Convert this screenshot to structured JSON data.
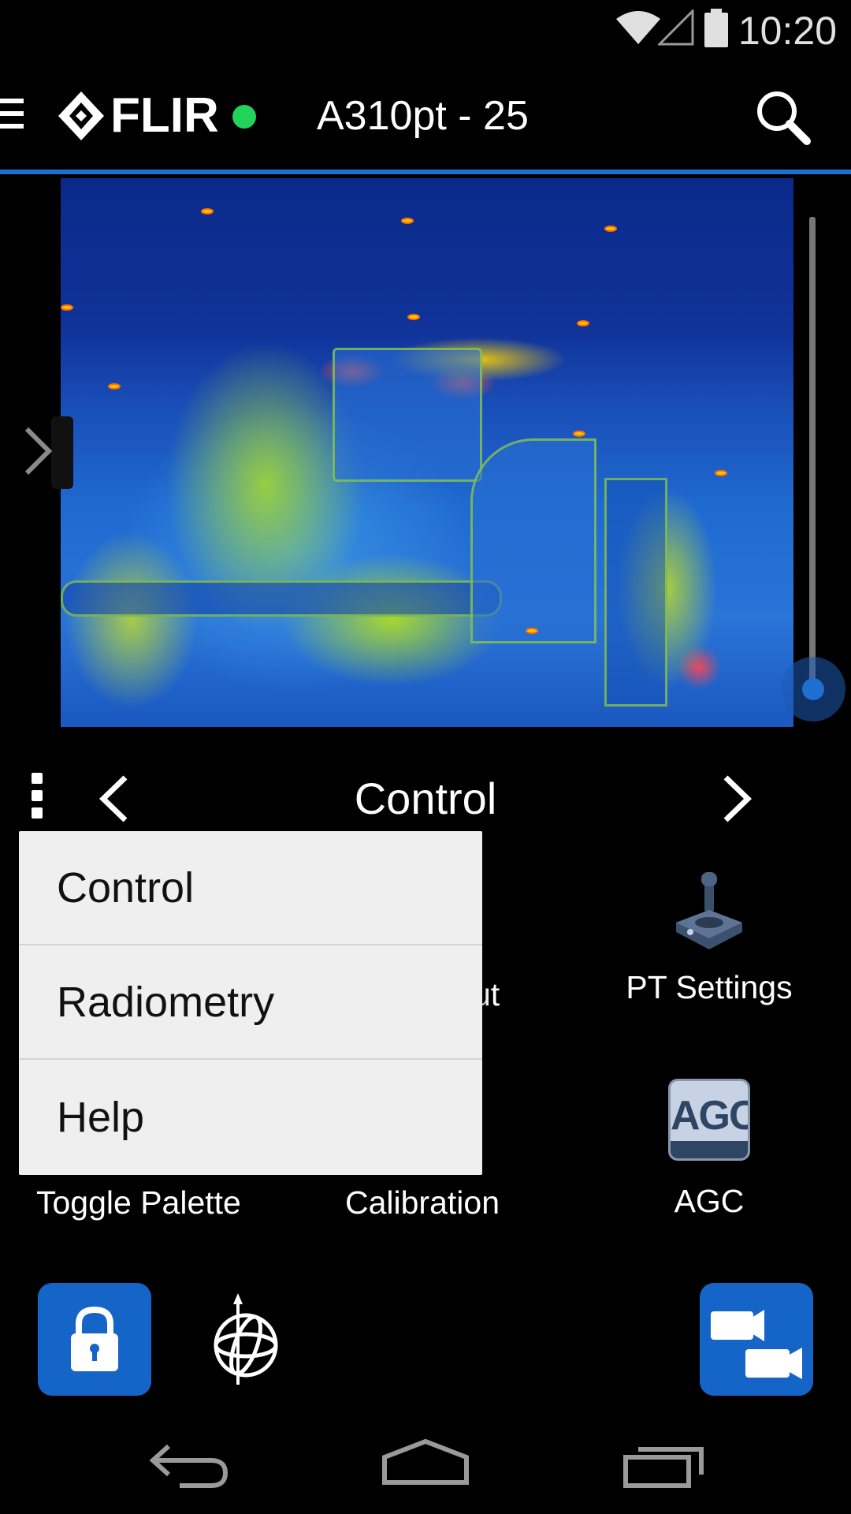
{
  "status_bar": {
    "time": "10:20",
    "icons": [
      "wifi-icon",
      "cell-signal-icon",
      "battery-icon"
    ]
  },
  "app_bar": {
    "brand": "FLIR",
    "connection_status_color": "#22d35a",
    "camera_name": "A310pt - 25",
    "icons": [
      "hamburger-menu-icon",
      "search-icon"
    ]
  },
  "colors": {
    "accent": "#1f6fd1",
    "button_blue": "#1565c8",
    "menu_background": "#efefef"
  },
  "thermal_view": {
    "palette": "rainbow-hc",
    "zoom_slider_level": 0.0
  },
  "control_panel": {
    "title": "Control",
    "tiles": {
      "pt_settings": "PT Settings",
      "agc_icon_text": "AGC",
      "agc": "AGC",
      "toggle_palette": "Toggle Palette",
      "calibration": "Calibration",
      "partially_hidden": "ut"
    }
  },
  "popup_menu": {
    "items": [
      "Control",
      "Radiometry",
      "Help"
    ]
  },
  "bottom_actions": {
    "icons": [
      "lock-icon",
      "gyroscope-icon",
      "camera-switch-icon"
    ]
  },
  "nav_bar": {
    "icons": [
      "back-icon",
      "home-icon",
      "recent-apps-icon"
    ]
  }
}
